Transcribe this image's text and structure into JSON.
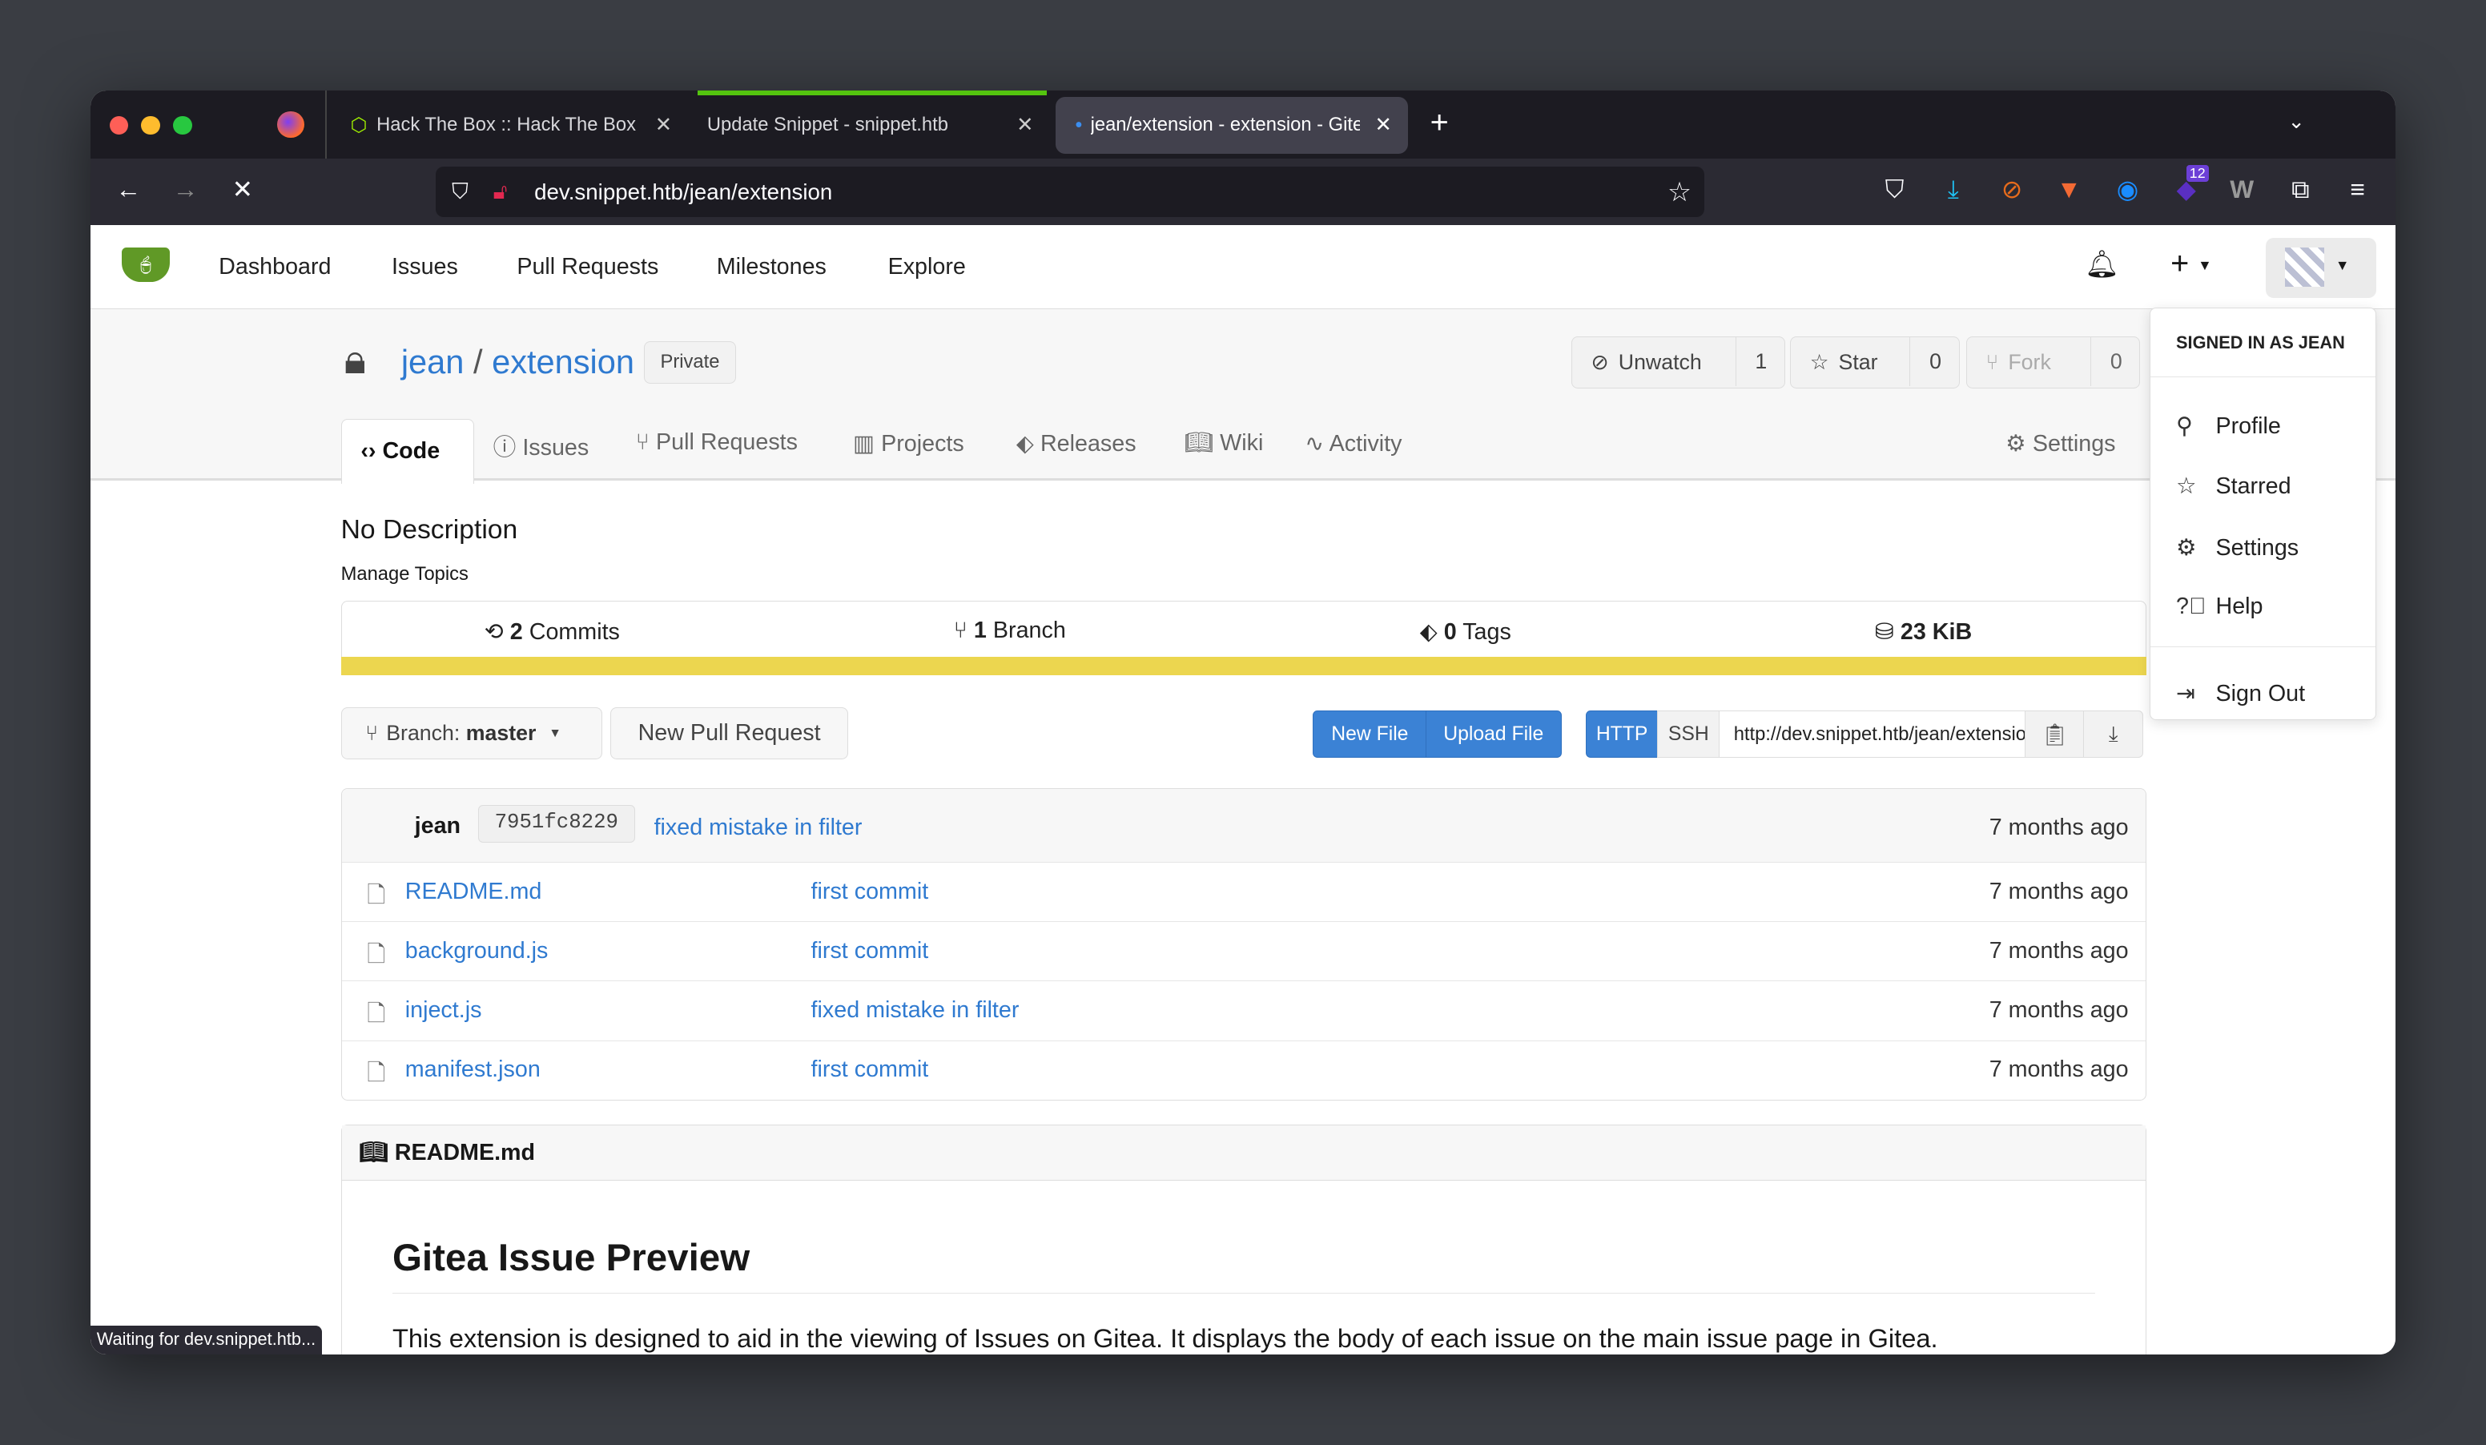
{
  "browser": {
    "tabs": [
      {
        "title": "Hack The Box :: Hack The Box",
        "icon": "htb-cube-icon"
      },
      {
        "title": "Update Snippet - snippet.htb"
      },
      {
        "title": "jean/extension - extension - Gitea",
        "active": true
      }
    ],
    "url": "dev.snippet.htb/jean/extension",
    "extension_badge": "12",
    "status": "Waiting for dev.snippet.htb..."
  },
  "gitea": {
    "nav": [
      "Dashboard",
      "Issues",
      "Pull Requests",
      "Milestones",
      "Explore"
    ],
    "user_menu": {
      "header": "SIGNED IN AS JEAN",
      "items": [
        "Profile",
        "Starred",
        "Settings",
        "Help",
        "Sign Out"
      ]
    },
    "repo": {
      "owner": "jean",
      "name": "extension",
      "visibility": "Private",
      "watch": {
        "label": "Unwatch",
        "count": "1"
      },
      "star": {
        "label": "Star",
        "count": "0"
      },
      "fork": {
        "label": "Fork",
        "count": "0"
      },
      "tabs": [
        "Code",
        "Issues",
        "Pull Requests",
        "Projects",
        "Releases",
        "Wiki",
        "Activity"
      ],
      "settings": "Settings",
      "description": "No Description",
      "manage_topics": "Manage Topics",
      "stats": {
        "commits": "2",
        "commits_label": "Commits",
        "branches": "1",
        "branches_label": "Branch",
        "tags": "0",
        "tags_label": "Tags",
        "size": "23 KiB"
      },
      "language_color": "#ecd64f",
      "branch_label": "Branch:",
      "branch": "master",
      "new_pr": "New Pull Request",
      "new_file": "New File",
      "upload_file": "Upload File",
      "clone": {
        "http": "HTTP",
        "ssh": "SSH",
        "url": "http://dev.snippet.htb/jean/extension.git"
      },
      "last_commit": {
        "author": "jean",
        "sha": "7951fc8229",
        "message": "fixed mistake in filter",
        "time": "7 months ago"
      },
      "files": [
        {
          "name": "README.md",
          "commit": "first commit",
          "time": "7 months ago"
        },
        {
          "name": "background.js",
          "commit": "first commit",
          "time": "7 months ago"
        },
        {
          "name": "inject.js",
          "commit": "fixed mistake in filter",
          "time": "7 months ago"
        },
        {
          "name": "manifest.json",
          "commit": "first commit",
          "time": "7 months ago"
        }
      ],
      "readme": {
        "title": "README.md",
        "heading": "Gitea Issue Preview",
        "text": "This extension is designed to aid in the viewing of Issues on Gitea. It displays the body of each issue on the main issue page in Gitea."
      }
    }
  }
}
